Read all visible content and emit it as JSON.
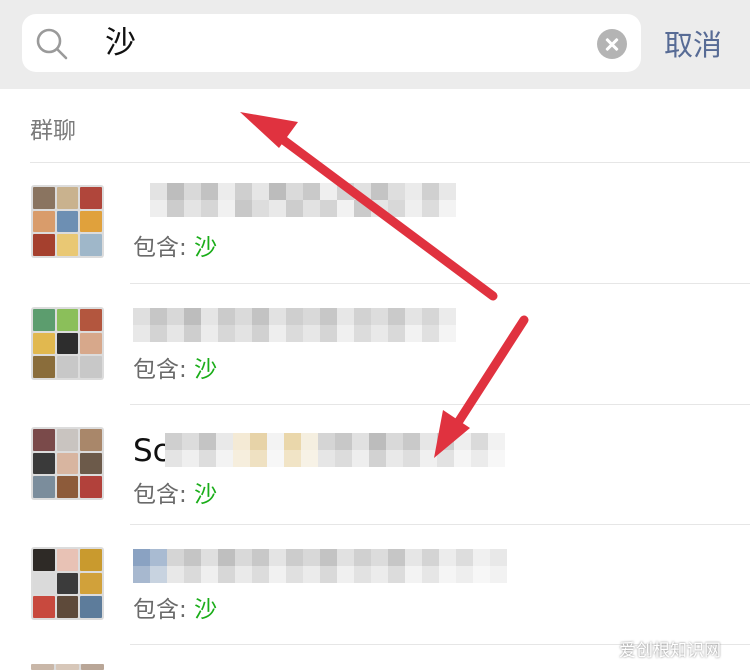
{
  "search": {
    "query": "沙",
    "cancel_label": "取消"
  },
  "section": {
    "title": "群聊"
  },
  "results": [
    {
      "name_visible": "",
      "contains_label": "包含: ",
      "match": "沙",
      "name_redacted": true
    },
    {
      "name_visible": "",
      "contains_label": "包含: ",
      "match": "沙",
      "name_redacted": true
    },
    {
      "name_visible": "Sc",
      "contains_label": "包含: ",
      "match": "沙",
      "name_redacted": true
    },
    {
      "name_visible": "",
      "contains_label": "包含: ",
      "match": "沙",
      "name_redacted": true
    }
  ],
  "annotations": {
    "arrow_color": "#e0323f"
  },
  "watermark": "爱创根知识网",
  "colors": {
    "match_green": "#1aad19",
    "cancel_blue": "#576b95",
    "topbar_gray": "#ececec"
  }
}
